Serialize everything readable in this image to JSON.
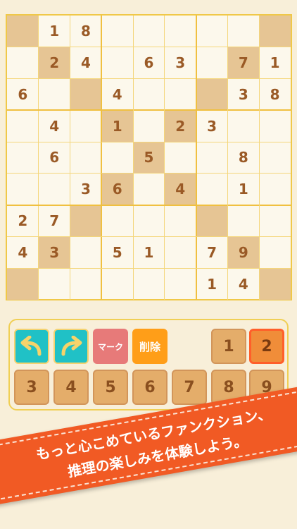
{
  "board": {
    "rows": [
      [
        "",
        "1",
        "8",
        "",
        "",
        "",
        "",
        "",
        ""
      ],
      [
        "",
        "2",
        "4",
        "",
        "6",
        "3",
        "",
        "7",
        "1"
      ],
      [
        "6",
        "",
        "",
        "4",
        "",
        "",
        "",
        "3",
        "8"
      ],
      [
        "",
        "4",
        "",
        "1",
        "",
        "2",
        "3",
        "",
        ""
      ],
      [
        "",
        "6",
        "",
        "",
        "5",
        "",
        "",
        "8",
        ""
      ],
      [
        "",
        "",
        "3",
        "6",
        "",
        "4",
        "",
        "1",
        ""
      ],
      [
        "2",
        "7",
        "",
        "",
        "",
        "",
        "",
        "",
        ""
      ],
      [
        "4",
        "3",
        "",
        "5",
        "1",
        "",
        "7",
        "9",
        ""
      ],
      [
        "",
        "",
        "",
        "",
        "",
        "",
        "1",
        "4",
        ""
      ]
    ],
    "shaded": [
      [
        0,
        0
      ],
      [
        0,
        8
      ],
      [
        1,
        1
      ],
      [
        1,
        7
      ],
      [
        2,
        2
      ],
      [
        2,
        6
      ],
      [
        3,
        3
      ],
      [
        3,
        5
      ],
      [
        4,
        4
      ],
      [
        5,
        3
      ],
      [
        5,
        5
      ],
      [
        6,
        2
      ],
      [
        6,
        6
      ],
      [
        7,
        1
      ],
      [
        7,
        7
      ],
      [
        8,
        0
      ],
      [
        8,
        8
      ]
    ]
  },
  "controls": {
    "undo_icon": "undo-arrow-icon",
    "redo_icon": "redo-arrow-icon",
    "mark_label": "マーク",
    "delete_label": "削除",
    "numbers": [
      "1",
      "2",
      "3",
      "4",
      "5",
      "6",
      "7",
      "8",
      "9"
    ],
    "selected_number": "2"
  },
  "banner": {
    "line1": "もっと心こめているファンクション、",
    "line2": "推理の楽しみを体験しよう。"
  },
  "colors": {
    "background": "#f8efd9",
    "grid_line": "#f0c040",
    "shaded_cell": "#e6c594",
    "digit": "#9a5a26",
    "teal_button": "#20c1c6",
    "mark_button": "#e77a79",
    "delete_button": "#ff9e18",
    "number_button": "#e4ad6a",
    "banner": "#f15a24"
  }
}
